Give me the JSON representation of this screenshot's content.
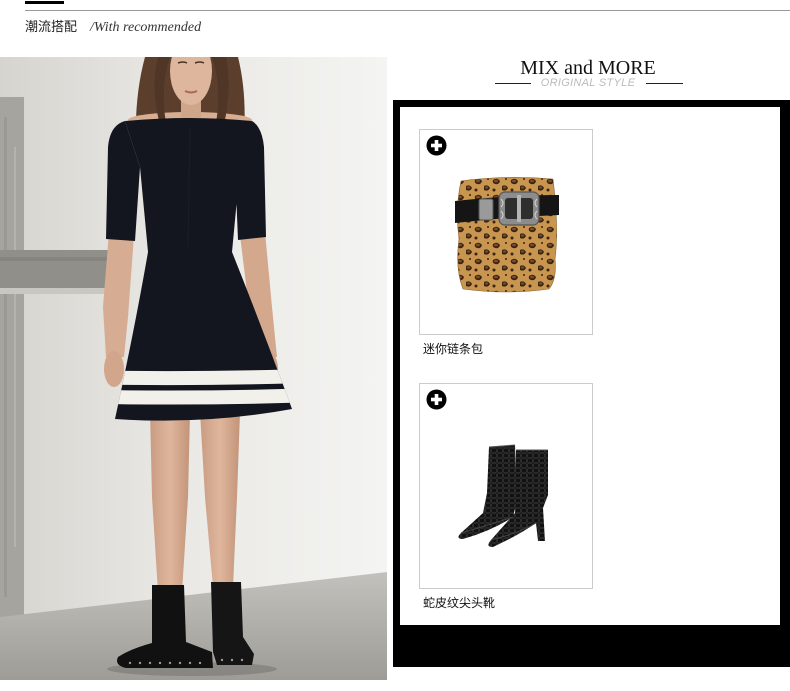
{
  "header": {
    "title_cn": "潮流搭配",
    "title_en": "/With recommended"
  },
  "mix": {
    "title": "MIX and MORE",
    "subtitle": "ORIGINAL STYLE"
  },
  "products": [
    {
      "name": "迷你链条包",
      "icon": "plus-circle-icon"
    },
    {
      "name": "蛇皮纹尖头靴",
      "icon": "plus-circle-icon"
    }
  ],
  "colors": {
    "frame": "#000000",
    "card_border": "#cccccc",
    "subtitle": "#bbbbbb",
    "rule": "#999999"
  }
}
